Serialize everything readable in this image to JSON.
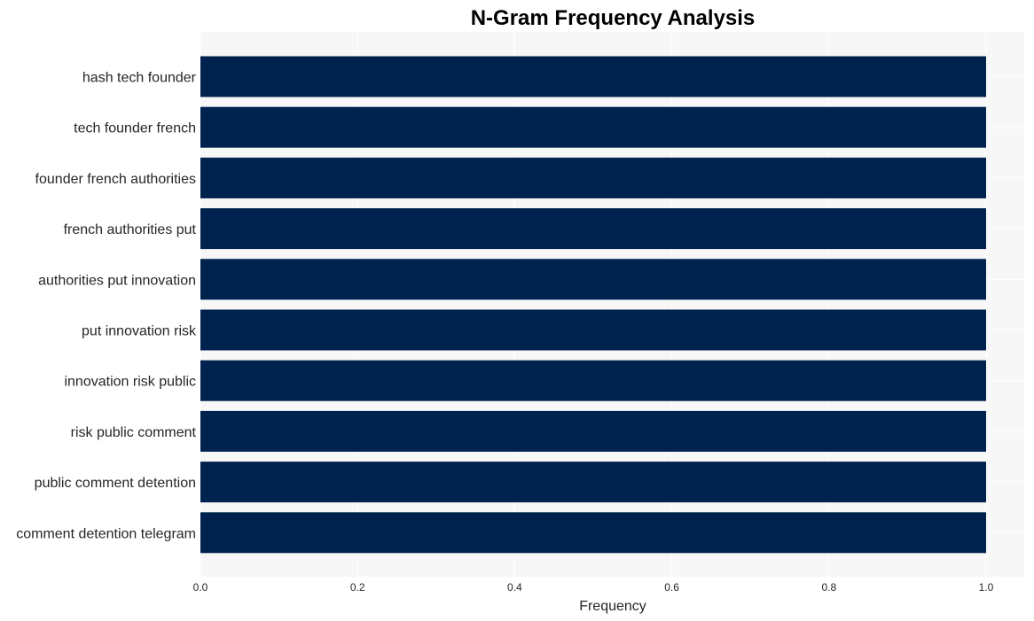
{
  "chart_data": {
    "type": "bar",
    "orientation": "horizontal",
    "title": "N-Gram Frequency Analysis",
    "xlabel": "Frequency",
    "ylabel": "",
    "categories": [
      "hash tech founder",
      "tech founder french",
      "founder french authorities",
      "french authorities put",
      "authorities put innovation",
      "put innovation risk",
      "innovation risk public",
      "risk public comment",
      "public comment detention",
      "comment detention telegram"
    ],
    "values": [
      1,
      1,
      1,
      1,
      1,
      1,
      1,
      1,
      1,
      1
    ],
    "xlim": [
      0,
      1.05
    ],
    "xticks": [
      0.0,
      0.2,
      0.4,
      0.6,
      0.8,
      1.0
    ],
    "xtick_labels": [
      "0.0",
      "0.2",
      "0.4",
      "0.6",
      "0.8",
      "1.0"
    ],
    "grid": true,
    "legend": "none",
    "colors": {
      "bar": "#00224e",
      "plot_background": "#f7f7f7",
      "grid": "#ffffff"
    }
  }
}
